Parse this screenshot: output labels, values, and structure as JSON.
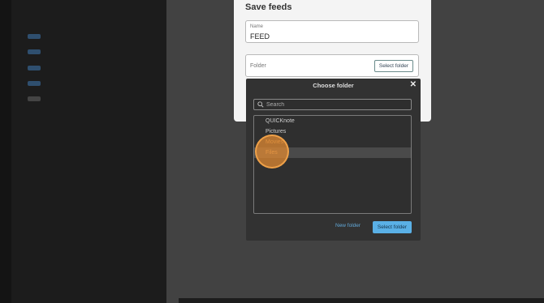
{
  "save_dialog": {
    "title": "Save feeds",
    "name_label": "Name",
    "name_value": "FEED",
    "folder_label": "Folder",
    "select_folder_label": "Select folder"
  },
  "choose_folder": {
    "title": "Choose folder",
    "close_glyph": "✕",
    "search_placeholder": "Search",
    "folders": [
      {
        "label": "QUICKnote"
      },
      {
        "label": "Pictures"
      },
      {
        "label": "Movies"
      },
      {
        "label": "Files"
      }
    ],
    "selected_folder": "Files",
    "new_folder_label": "New folder",
    "select_folder_label": "Select folder"
  },
  "colors": {
    "accent_blue": "#5ab0e6",
    "link_blue": "#62a8d8",
    "highlight_orange": "#e68c32"
  },
  "icons": {
    "search": "search-icon",
    "close": "close-icon"
  }
}
